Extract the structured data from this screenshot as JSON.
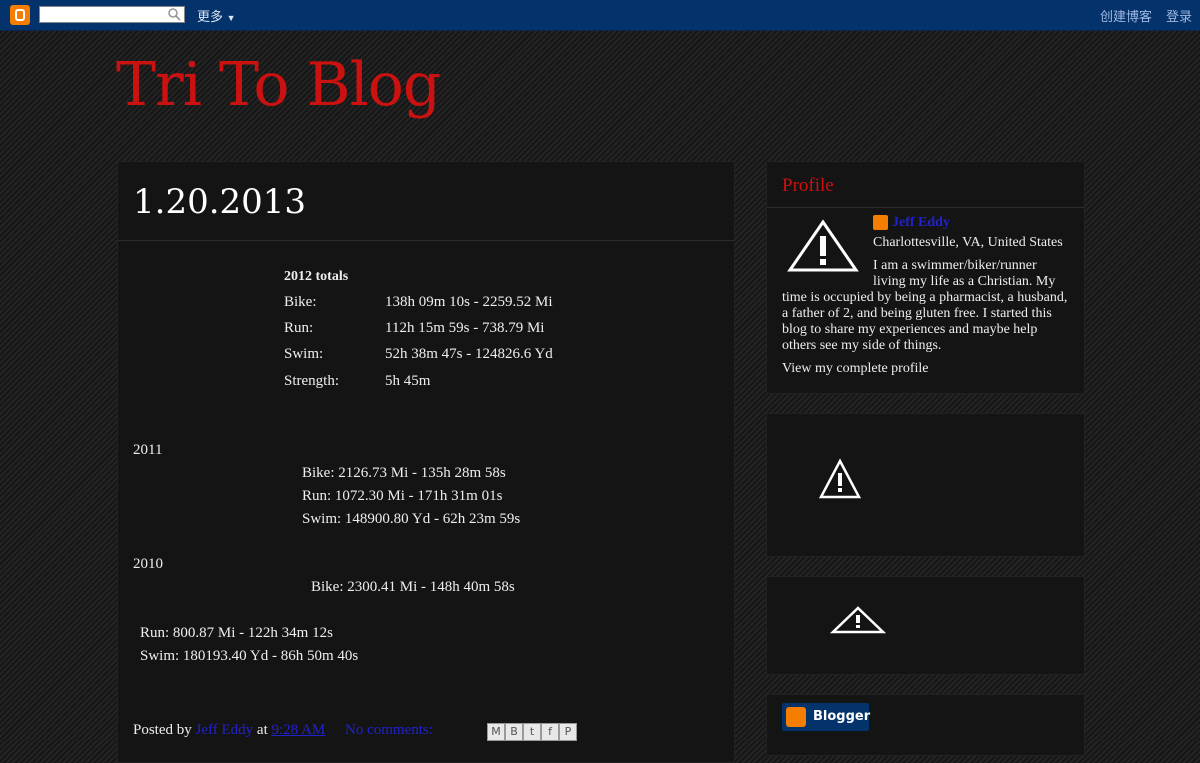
{
  "navbar": {
    "more_label": "更多",
    "create_blog_label": "创建博客",
    "login_label": "登录"
  },
  "blog": {
    "title": "Tri To Blog"
  },
  "post": {
    "title": "1.20.2013",
    "totals_2012": {
      "heading": "2012 totals",
      "rows": [
        {
          "label": "Bike:",
          "value": "138h 09m 10s  - 2259.52 Mi"
        },
        {
          "label": "Run:",
          "value": "112h 15m 59s  - 738.79 Mi"
        },
        {
          "label": "Swim:",
          "value": "52h 38m 47s  - 124826.6 Yd"
        },
        {
          "label": "Strength:",
          "value": "5h 45m"
        }
      ]
    },
    "year_2011": {
      "heading": "2011",
      "lines": [
        "Bike:  2126.73 Mi - 135h 28m 58s",
        "Run:  1072.30 Mi - 171h 31m 01s",
        "Swim:  148900.80 Yd - 62h 23m 59s"
      ]
    },
    "year_2010": {
      "heading": "2010",
      "lines": [
        "Bike: 2300.41 Mi - 148h 40m 58s",
        "Run:  800.87 Mi - 122h 34m 12s",
        "Swim:  180193.40 Yd - 86h 50m 40s"
      ]
    },
    "footer": {
      "posted_by": "Posted by",
      "author": "Jeff Eddy",
      "at": "at",
      "time": "9:28 AM",
      "comments": "No comments:"
    }
  },
  "sidebar": {
    "profile": {
      "title": "Profile",
      "name": "Jeff Eddy",
      "location": "Charlottesville, VA, United States",
      "bio_line1": "I am a swimmer/biker/runner",
      "bio_line2": "living my life as a Christian. My",
      "bio_line3": "time is occupied by being a pharmacist, a husband,",
      "bio_line4": "a father of 2, and being gluten free. I started this",
      "bio_line5": "blog to share my experiences and maybe help",
      "bio_line6": "others see my side of things.",
      "view_profile": "View my complete profile"
    },
    "blogger_badge": "Blogger"
  },
  "colors": {
    "navbar": "#04326b",
    "title_red": "#cc1111",
    "link_blue": "#2222cc",
    "blogger_orange": "#f57d00"
  }
}
